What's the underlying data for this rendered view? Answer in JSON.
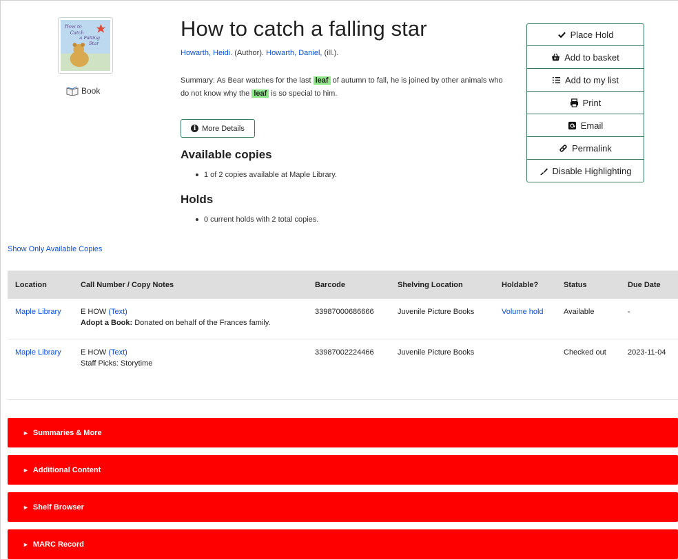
{
  "record": {
    "title": "How to catch a falling star",
    "author1": "Howarth, Heidi.",
    "author1_role": "(Author).",
    "author2": "Howarth, Daniel,",
    "author2_role": "(ill.).",
    "format": "Book",
    "cover_alt": "How to Catch a Falling Star",
    "summary_pre": "Summary: As Bear watches for the last",
    "summary_hl1": "leaf",
    "summary_mid": "of autumn to fall, he is joined by other animals who do not know why the",
    "summary_hl2": "leaf",
    "summary_post": "is so special to him.",
    "more_details": "More Details"
  },
  "availability": {
    "heading": "Available copies",
    "line": "1 of 2 copies available at Maple Library."
  },
  "holds": {
    "heading": "Holds",
    "line": "0 current holds with 2 total copies."
  },
  "actions": [
    {
      "label": "Place Hold",
      "icon": "check-icon"
    },
    {
      "label": "Add to basket",
      "icon": "basket-icon"
    },
    {
      "label": "Add to my list",
      "icon": "list-icon"
    },
    {
      "label": "Print",
      "icon": "print-icon"
    },
    {
      "label": "Email",
      "icon": "email-icon"
    },
    {
      "label": "Permalink",
      "icon": "link-icon"
    },
    {
      "label": "Disable Highlighting",
      "icon": "highlighter-icon"
    }
  ],
  "show_available": "Show Only Available Copies",
  "table": {
    "headers": [
      "Location",
      "Call Number / Copy Notes",
      "Barcode",
      "Shelving Location",
      "Holdable?",
      "Status",
      "Due Date"
    ],
    "rows": [
      {
        "location": "Maple Library",
        "call": "E HOW",
        "call_link": "(Text)",
        "note_label": "Adopt a Book:",
        "note_text": "Donated on behalf of the Frances family.",
        "barcode": "33987000686666",
        "shelving": "Juvenile Picture Books",
        "holdable": "Volume hold",
        "status": "Available",
        "due": "-"
      },
      {
        "location": "Maple Library",
        "call": "E HOW",
        "call_link": "(Text)",
        "note_label": "",
        "note_text": "Staff Picks: Storytime",
        "barcode": "33987002224466",
        "shelving": "Juvenile Picture Books",
        "holdable": "",
        "status": "Checked out",
        "due": "2023-11-04"
      }
    ]
  },
  "sections": [
    "Summaries & More",
    "Additional Content",
    "Shelf Browser",
    "MARC Record"
  ],
  "colors": {
    "accent_border": "#3b7a5c",
    "section_bg": "#ff0000",
    "highlight": "#8ee58a",
    "link": "#0b4fd6"
  }
}
